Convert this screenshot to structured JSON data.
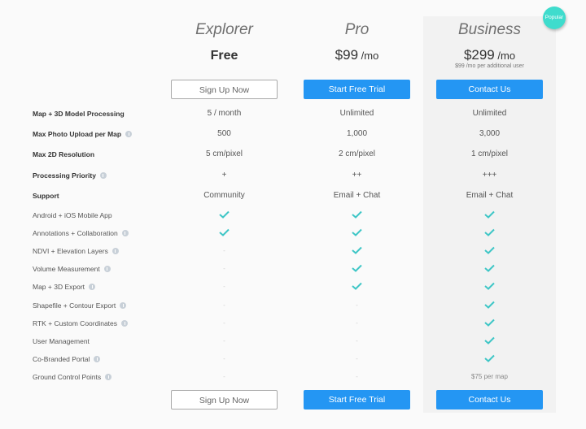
{
  "badge": "Popular",
  "plans": [
    {
      "name": "Explorer",
      "price": "Free",
      "price_unit": "",
      "price_sub": "",
      "cta": "Sign Up Now",
      "cta_style": "outline"
    },
    {
      "name": "Pro",
      "price": "$99",
      "price_unit": "/mo",
      "price_sub": "",
      "cta": "Start Free Trial",
      "cta_style": "primary"
    },
    {
      "name": "Business",
      "price": "$299",
      "price_unit": "/mo",
      "price_sub": "$99 /mo per additional user",
      "cta": "Contact Us",
      "cta_style": "primary"
    }
  ],
  "colors": {
    "accent_blue": "#2496f3",
    "check_teal": "#3ec6c6",
    "badge_teal": "#3fdccd"
  },
  "rows": [
    {
      "label": "Map + 3D Model Processing",
      "bold": true,
      "info": false,
      "values": [
        "5 / month",
        "Unlimited",
        "Unlimited"
      ]
    },
    {
      "label": "Max Photo Upload per Map",
      "bold": true,
      "info": true,
      "values": [
        "500",
        "1,000",
        "3,000"
      ]
    },
    {
      "label": "Max 2D Resolution",
      "bold": true,
      "info": false,
      "values": [
        "5 cm/pixel",
        "2 cm/pixel",
        "1 cm/pixel"
      ]
    },
    {
      "label": "Processing Priority",
      "bold": true,
      "info": true,
      "values": [
        "+",
        "++",
        "+++"
      ]
    },
    {
      "label": "Support",
      "bold": true,
      "info": false,
      "values": [
        "Community",
        "Email + Chat",
        "Email + Chat"
      ]
    },
    {
      "label": "Android + iOS Mobile App",
      "bold": false,
      "info": false,
      "values": [
        "check",
        "check",
        "check"
      ]
    },
    {
      "label": "Annotations + Collaboration",
      "bold": false,
      "info": true,
      "values": [
        "check",
        "check",
        "check"
      ]
    },
    {
      "label": "NDVI + Elevation Layers",
      "bold": false,
      "info": true,
      "values": [
        "-",
        "check",
        "check"
      ]
    },
    {
      "label": "Volume Measurement",
      "bold": false,
      "info": true,
      "values": [
        "-",
        "check",
        "check"
      ]
    },
    {
      "label": "Map + 3D Export",
      "bold": false,
      "info": true,
      "values": [
        "-",
        "check",
        "check"
      ]
    },
    {
      "label": "Shapefile + Contour Export",
      "bold": false,
      "info": true,
      "values": [
        "-",
        "-",
        "check"
      ]
    },
    {
      "label": "RTK + Custom Coordinates",
      "bold": false,
      "info": true,
      "values": [
        "-",
        "-",
        "check"
      ]
    },
    {
      "label": "User Management",
      "bold": false,
      "info": false,
      "values": [
        "-",
        "-",
        "check"
      ]
    },
    {
      "label": "Co-Branded Portal",
      "bold": false,
      "info": true,
      "values": [
        "-",
        "-",
        "check"
      ]
    },
    {
      "label": "Ground Control Points",
      "bold": false,
      "info": true,
      "values": [
        "-",
        "-",
        "$75 per map"
      ]
    }
  ]
}
